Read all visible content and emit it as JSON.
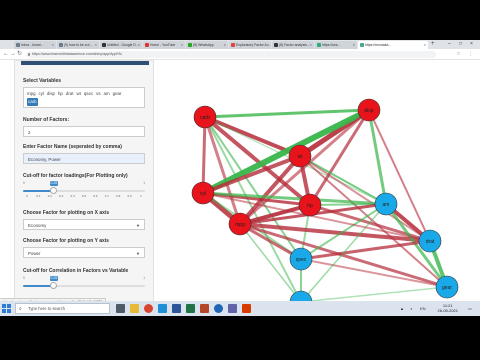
{
  "browser": {
    "tabs": [
      {
        "label": "Inbox - kmari..."
      },
      {
        "label": "(9) how to be a d..."
      },
      {
        "label": "Untitled - Google D..."
      },
      {
        "label": "Home - YouTube"
      },
      {
        "label": "(8) WhatsApp"
      },
      {
        "label": "Exploratory Factor A..."
      },
      {
        "label": "(8) Factor analysis..."
      },
      {
        "label": "https://ses..."
      },
      {
        "label": "https://renutaka..."
      }
    ],
    "new_tab": "+",
    "url": "https://www.learnwithdatascience.com/shiny/app/AppFA/",
    "status_url": "https://www.learnwithdatascience.com/shiny/app/AppFA/#tabSetUG38"
  },
  "sidebar": {
    "select_variables": {
      "label": "Select Variables",
      "chips": [
        "mpg",
        "cyl",
        "disp",
        "hp",
        "drat",
        "wt",
        "qsec",
        "vs",
        "am",
        "gear",
        "carb"
      ],
      "selected": "carb"
    },
    "num_factors": {
      "label": "Number of Factors:",
      "value": "2"
    },
    "factor_names": {
      "label": "Enter Factor Name (seperated by comma)",
      "value": "Economy, Power"
    },
    "cutoff_loadings": {
      "label": "Cut-off for factor loadings(For Plotting only)",
      "min": "0",
      "max": "1",
      "value": "0.25",
      "fraction": 0.25,
      "ticks": [
        "0",
        "0.1",
        "0.2",
        "0.3",
        "0.4",
        "0.5",
        "0.6",
        "0.7",
        "0.8",
        "0.9",
        "1"
      ]
    },
    "x_axis": {
      "label": "Choose Factor for plotting on X axis",
      "value": "Economy"
    },
    "y_axis": {
      "label": "Choose Factor for plotting on Y axis",
      "value": "Power"
    },
    "cutoff_corr": {
      "label": "Cut-off for Correlation in Factors vs Variable",
      "min": "0",
      "max": "1",
      "value": "0.25",
      "fraction": 0.25
    }
  },
  "network": {
    "node_colors": {
      "red": "#e8131b",
      "blue": "#1aa9e8"
    },
    "edge_colors": {
      "negative": "#b52c3a",
      "positive": "#39b54a"
    },
    "nodes": [
      "carb",
      "disp",
      "wt",
      "cyl",
      "hp",
      "mpg",
      "am",
      "qsec",
      "drat",
      "gear",
      "vs"
    ]
  },
  "taskbar": {
    "search_placeholder": "Type here to search",
    "time": "11:21",
    "date": "26-05-2021"
  }
}
